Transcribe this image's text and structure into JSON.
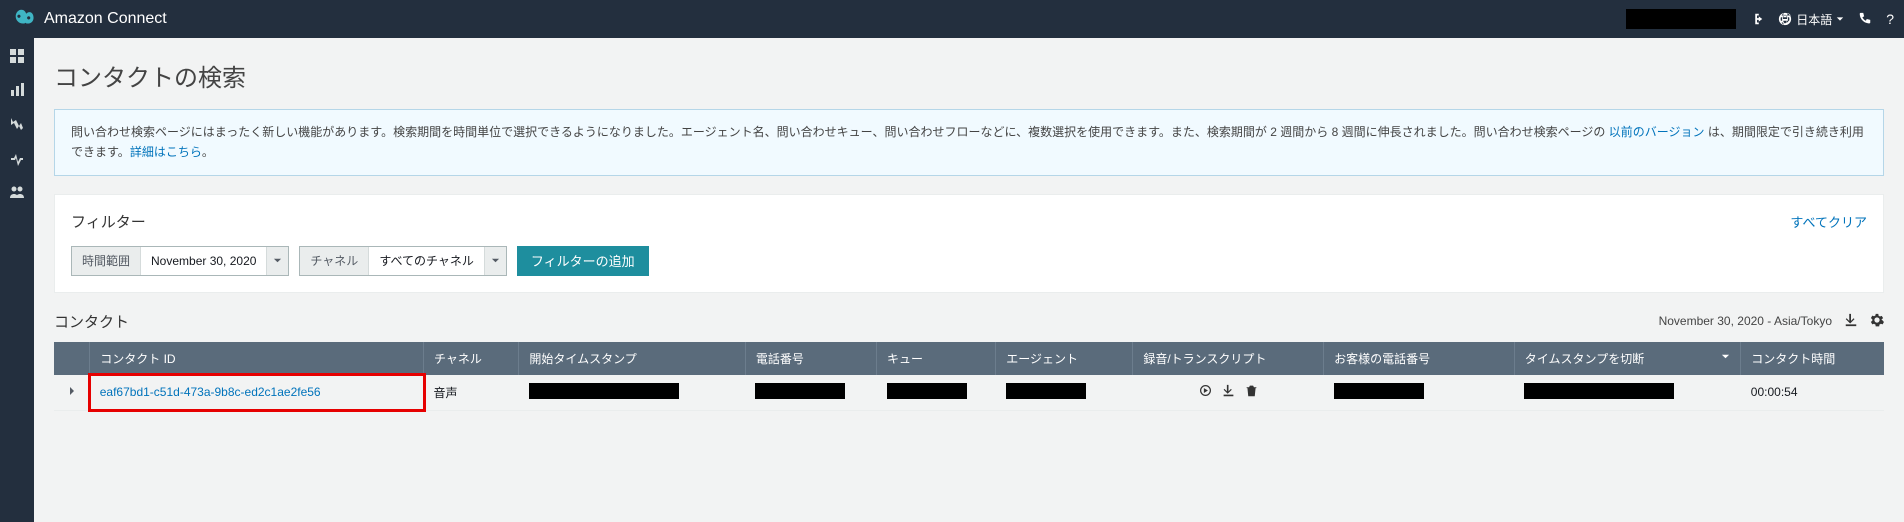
{
  "header": {
    "app_name": "Amazon Connect",
    "language_label": "日本語"
  },
  "page": {
    "title": "コンタクトの検索"
  },
  "banner": {
    "text_prefix": "問い合わせ検索ページにはまったく新しい機能があります。検索期間を時間単位で選択できるようになりました。エージェント名、問い合わせキュー、問い合わせフローなどに、複数選択を使用できます。また、検索期間が 2 週間から 8 週間に伸長されました。問い合わせ検索ページの ",
    "link1": "以前のバージョン",
    "text_mid": " は、期間限定で引き続き利用できます。",
    "link2": "詳細はこちら",
    "text_suffix": "。"
  },
  "filters": {
    "panel_title": "フィルター",
    "clear_all": "すべてクリア",
    "time_range": {
      "label": "時間範囲",
      "value": "November 30, 2020"
    },
    "channel": {
      "label": "チャネル",
      "value": "すべてのチャネル"
    },
    "add_button": "フィルターの追加"
  },
  "contacts": {
    "panel_title": "コンタクト",
    "range_text": "November 30, 2020 - Asia/Tokyo",
    "columns": {
      "contact_id": "コンタクト ID",
      "channel": "チャネル",
      "start_ts": "開始タイムスタンプ",
      "phone": "電話番号",
      "queue": "キュー",
      "agent": "エージェント",
      "rec": "録音/トランスクリプト",
      "cust_phone": "お客様の電話番号",
      "disc_ts": "タイムスタンプを切断",
      "contact_dur": "コンタクト時間"
    },
    "rows": [
      {
        "contact_id": "eaf67bd1-c51d-473a-9b8c-ed2c1ae2fe56",
        "channel": "音声",
        "duration": "00:00:54"
      }
    ]
  }
}
